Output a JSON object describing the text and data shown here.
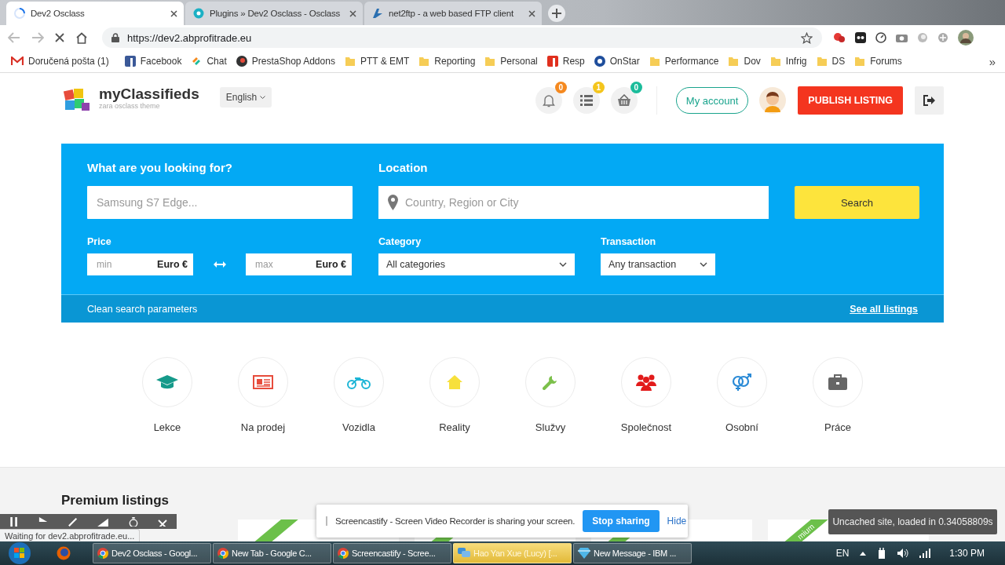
{
  "browser": {
    "tabs": [
      {
        "title": "Dev2 Osclass",
        "kind": "loading",
        "selected": true
      },
      {
        "title": "Plugins » Dev2 Osclass - Osclass",
        "kind": "plugin",
        "selected": false
      },
      {
        "title": "net2ftp - a web based FTP client",
        "kind": "ftp",
        "selected": false
      }
    ],
    "url": "https://dev2.abprofitrade.eu",
    "bookmarks": [
      {
        "label": "Doručená pošta (1)",
        "kind": "mail"
      },
      {
        "label": "Facebook",
        "kind": "site",
        "color": "#3b5998"
      },
      {
        "label": "Chat",
        "kind": "chat"
      },
      {
        "label": "PrestaShop Addons",
        "kind": "presta"
      },
      {
        "label": "PTT & EMT",
        "kind": "folder"
      },
      {
        "label": "Reporting",
        "kind": "folder"
      },
      {
        "label": "Personal",
        "kind": "folder"
      },
      {
        "label": "Resp",
        "kind": "site",
        "color": "#e0301e"
      },
      {
        "label": "OnStar",
        "kind": "round",
        "color": "#1f4e9c"
      },
      {
        "label": "Performance",
        "kind": "folder"
      },
      {
        "label": "Dov",
        "kind": "folder"
      },
      {
        "label": "Infrig",
        "kind": "folder"
      },
      {
        "label": "DS",
        "kind": "folder"
      },
      {
        "label": "Forums",
        "kind": "folder"
      }
    ],
    "overflow": "»"
  },
  "header": {
    "brand": "myClassifieds",
    "tagline": "zara osclass theme",
    "language": "English",
    "badges": [
      {
        "kind": "bell",
        "count": "0",
        "color": "#f5891f"
      },
      {
        "kind": "list",
        "count": "1",
        "color": "#f4c51c"
      },
      {
        "kind": "basket",
        "count": "0",
        "color": "#1bbc9b"
      }
    ],
    "account": "My account",
    "publish": "PUBLISH LISTING"
  },
  "search": {
    "query_label": "What are you looking for?",
    "query_placeholder": "Samsung S7 Edge...",
    "location_label": "Location",
    "location_placeholder": "Country, Region or City",
    "button": "Search",
    "price_label": "Price",
    "min_placeholder": "min",
    "min_currency": "Euro €",
    "max_placeholder": "max",
    "max_currency": "Euro €",
    "category_label": "Category",
    "category_value": "All categories",
    "transaction_label": "Transaction",
    "transaction_value": "Any transaction",
    "clean": "Clean search parameters",
    "see_all": "See all listings"
  },
  "categories": [
    {
      "label": "Lekce",
      "kind": "cap",
      "color": "#159a8a"
    },
    {
      "label": "Na prodej",
      "kind": "news",
      "color": "#e74c3c"
    },
    {
      "label": "Vozidla",
      "kind": "moto",
      "color": "#1cb5d6"
    },
    {
      "label": "Reality",
      "kind": "house",
      "color": "#f7e03c"
    },
    {
      "label": "Služvy",
      "kind": "wrench",
      "color": "#7cc04b"
    },
    {
      "label": "Společnost",
      "kind": "people",
      "color": "#e21b1b"
    },
    {
      "label": "Osobní",
      "kind": "gender",
      "color": "#2a8ad6"
    },
    {
      "label": "Práce",
      "kind": "case",
      "color": "#666666"
    }
  ],
  "premium": {
    "heading": "Premium listings",
    "cards": [
      {
        "kind": "listing"
      },
      {
        "kind": "listing"
      },
      {
        "kind": "listing"
      },
      {
        "kind": "listing",
        "ribbon": "mium"
      }
    ]
  },
  "overlays": {
    "status": "Waiting for dev2.abprofitrade.eu...",
    "share_text": "Screencastify - Screen Video Recorder is sharing your screen.",
    "stop": "Stop sharing",
    "hide": "Hide",
    "toast": "Uncached site, loaded in 0.34058809s"
  },
  "taskbar": {
    "items": [
      {
        "label": "Dev2 Osclass - Googl...",
        "kind": "chrome",
        "flashing": false
      },
      {
        "label": "New Tab - Google C...",
        "kind": "chrome",
        "flashing": false
      },
      {
        "label": "Screencastify - Scree...",
        "kind": "chrome",
        "flashing": false
      },
      {
        "label": "Hao Yan Xue (Lucy) [...",
        "kind": "chat",
        "flashing": true
      },
      {
        "label": "New Message - IBM ...",
        "kind": "gem",
        "flashing": false
      }
    ],
    "language": "EN",
    "time": "1:30 PM"
  }
}
